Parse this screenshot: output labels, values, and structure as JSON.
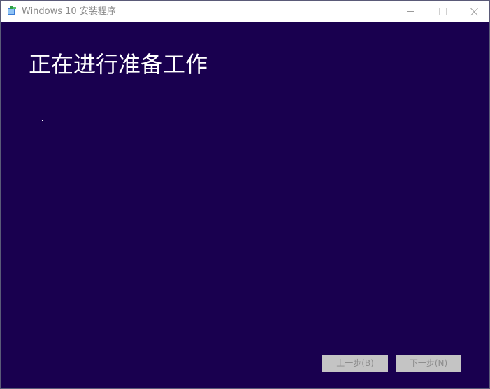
{
  "window": {
    "title": "Windows 10 安装程序",
    "icon": "setup-app-icon"
  },
  "titlebar_controls": {
    "minimize_icon": "minimize-icon",
    "maximize_icon": "maximize-icon",
    "close_icon": "close-icon"
  },
  "main": {
    "heading": "正在进行准备工作",
    "progress_indicator": "dot-animation"
  },
  "buttons": {
    "back_label": "上一步(B)",
    "back_enabled": false,
    "next_label": "下一步(N)",
    "next_enabled": false
  },
  "colors": {
    "background": "#19004f",
    "heading": "#ffffff",
    "disabled_button": "#c4c4c4",
    "disabled_text": "#8d8d8d"
  }
}
